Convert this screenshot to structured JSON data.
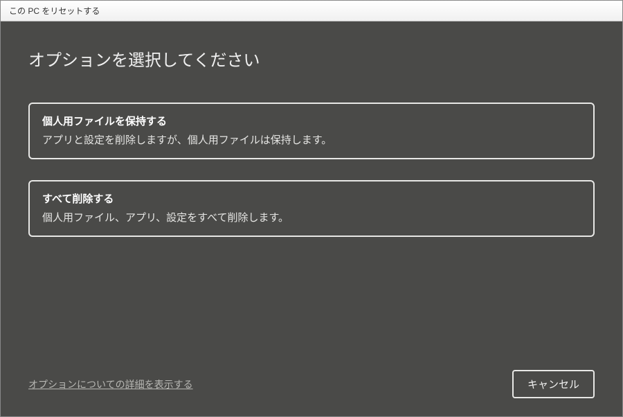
{
  "window": {
    "title": "この PC をリセットする"
  },
  "main": {
    "heading": "オプションを選択してください",
    "options": [
      {
        "title": "個人用ファイルを保持する",
        "description": "アプリと設定を削除しますが、個人用ファイルは保持します。"
      },
      {
        "title": "すべて削除する",
        "description": "個人用ファイル、アプリ、設定をすべて削除します。"
      }
    ]
  },
  "footer": {
    "details_link": "オプションについての詳細を表示する",
    "cancel_label": "キャンセル"
  }
}
